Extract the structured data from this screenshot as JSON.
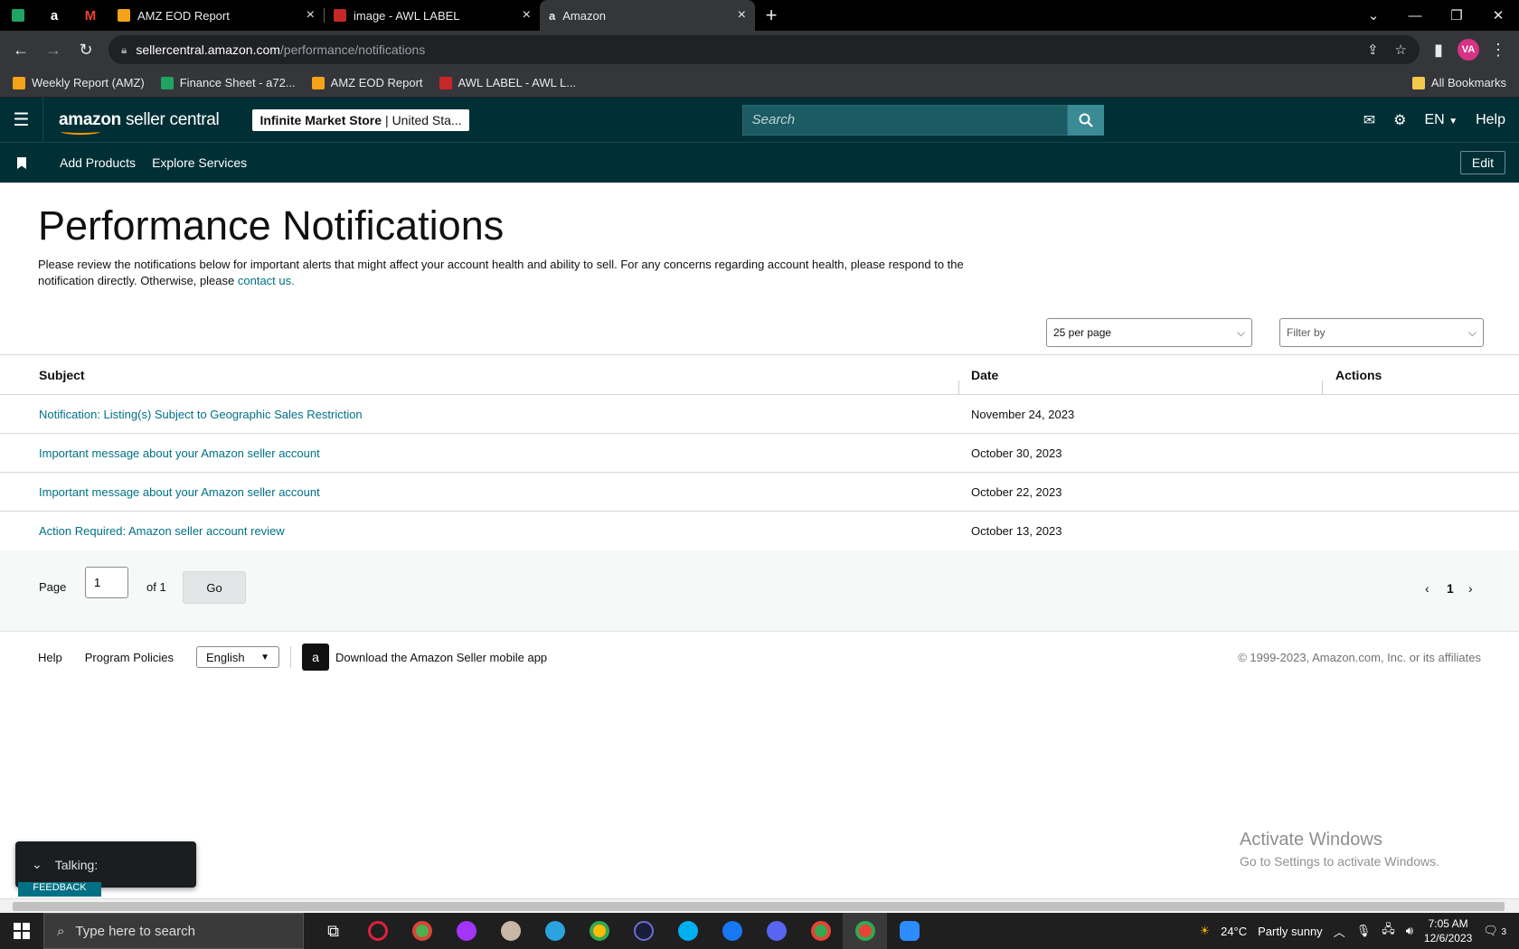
{
  "browser": {
    "tabs": [
      {
        "title": "AMZ EOD Report",
        "active": false
      },
      {
        "title": "image - AWL LABEL",
        "active": false
      },
      {
        "title": "Amazon",
        "active": true
      }
    ],
    "url_host": "sellercentral.amazon.com",
    "url_path": "/performance/notifications",
    "profile_initials": "VA",
    "bookmarks": [
      "Weekly Report (AMZ)",
      "Finance Sheet - a72...",
      "AMZ EOD Report",
      "AWL LABEL - AWL L..."
    ],
    "all_bookmarks": "All Bookmarks"
  },
  "header": {
    "logo_brand": "amazon",
    "logo_suffix": "seller central",
    "store_name": "Infinite Market Store",
    "store_market": "| United Sta...",
    "search_placeholder": "Search",
    "language": "EN",
    "help": "Help"
  },
  "subnav": {
    "links": [
      "Add Products",
      "Explore Services"
    ],
    "edit": "Edit"
  },
  "page": {
    "title": "Performance Notifications",
    "intro": "Please review the notifications below for important alerts that might affect your account health and ability to sell. For any concerns regarding account health, please respond to the notification directly. Otherwise, please",
    "intro_link": "contact us.",
    "per_page": "25 per page",
    "filter_by": "Filter by"
  },
  "table": {
    "headers": {
      "subject": "Subject",
      "date": "Date",
      "actions": "Actions"
    },
    "rows": [
      {
        "subject": "Notification: Listing(s) Subject to Geographic Sales Restriction",
        "date": "November 24, 2023"
      },
      {
        "subject": "Important message about your Amazon seller account",
        "date": "October 30, 2023"
      },
      {
        "subject": "Important message about your Amazon seller account",
        "date": "October 22, 2023"
      },
      {
        "subject": "Action Required: Amazon seller account review",
        "date": "October 13, 2023"
      }
    ]
  },
  "pager": {
    "page_label": "Page",
    "page_value": "1",
    "of_label": "of 1",
    "go": "Go",
    "current": "1"
  },
  "footer": {
    "help": "Help",
    "program_policies": "Program Policies",
    "language": "English",
    "app_download": "Download the Amazon Seller mobile app",
    "copyright": "© 1999-2023, Amazon.com, Inc. or its affiliates"
  },
  "overlay": {
    "talking": "Talking:",
    "feedback": "FEEDBACK",
    "activate_title": "Activate Windows",
    "activate_sub": "Go to Settings to activate Windows."
  },
  "taskbar": {
    "search_placeholder": "Type here to search",
    "weather_temp": "24°C",
    "weather_desc": "Partly sunny",
    "time": "7:05 AM",
    "date": "12/6/2023",
    "notifications": "3"
  }
}
